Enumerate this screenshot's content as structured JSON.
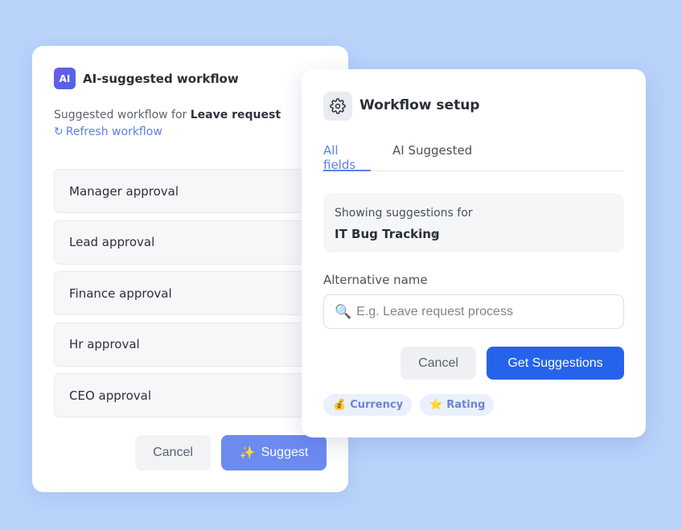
{
  "left_card": {
    "badge": "AI",
    "title": "AI-suggested workflow",
    "suggest_prefix": "Suggested workflow for",
    "suggest_target": "Leave request",
    "refresh_icon": "↻",
    "refresh_label": "Refresh workflow",
    "steps": [
      "Manager approval",
      "Lead approval",
      "Finance approval",
      "Hr approval",
      "CEO approval"
    ],
    "cancel_label": "Cancel",
    "suggest_icon": "✨",
    "suggest_label": "Suggest"
  },
  "right_card": {
    "title": "Workflow setup",
    "tabs": [
      {
        "label": "All fields",
        "active": true
      },
      {
        "label": "AI Suggested",
        "active": false
      }
    ],
    "info_label": "Showing suggestions for",
    "info_value": "IT Bug Tracking",
    "info_chevron": "v",
    "alt_name_label": "Alternative name",
    "search_icon": "🔍",
    "search_placeholder": "E.g. Leave request process",
    "search_value": "",
    "cancel_label": "Cancel",
    "get_label": "Get Suggestions",
    "chips": [
      {
        "icon": "💰",
        "label": "Currency"
      },
      {
        "icon": "⭐",
        "label": "Rating"
      }
    ]
  },
  "colors": {
    "background": "#b9d3fb",
    "accent": "#5e7fe8",
    "primary_button": "#2563eb",
    "suggest_button": "#6c8af0"
  }
}
